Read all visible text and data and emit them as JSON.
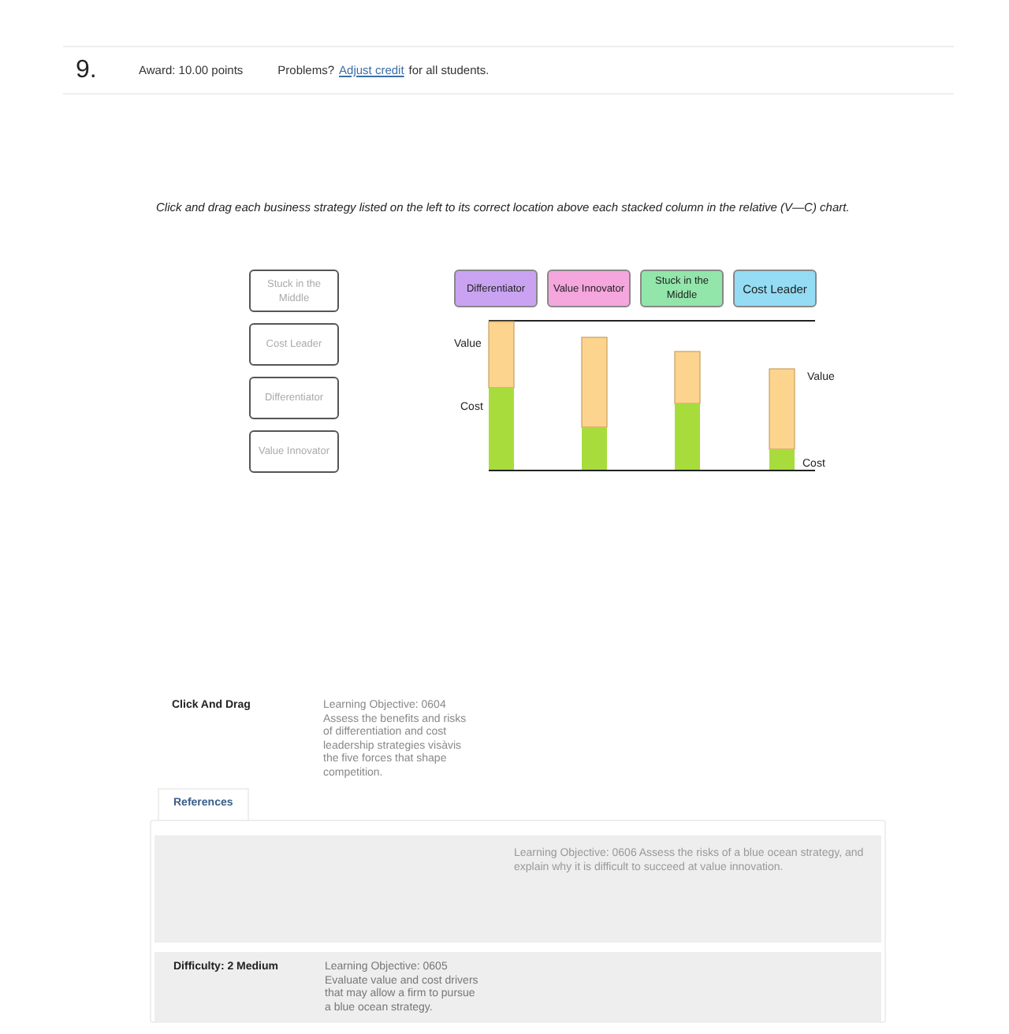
{
  "question": {
    "number": "9.",
    "award": "Award: 10.00 points",
    "problems_label": "Problems?",
    "adjust_link": "Adjust credit",
    "adjust_suffix": "for all students."
  },
  "instructions": "Click and drag each business strategy listed on the left to its correct location above each stacked column in the relative (V—C) chart.",
  "drag_items": [
    "Stuck in the Middle",
    "Cost Leader",
    "Differentiator",
    "Value Innovator"
  ],
  "drop_targets": [
    {
      "label": "Differentiator",
      "color": "#c9a3f2"
    },
    {
      "label": "Value Innovator",
      "color": "#f4a6dd"
    },
    {
      "label": "Stuck in the Middle",
      "color": "#92e6aa"
    },
    {
      "label": "Cost Leader",
      "color": "#94dcf4"
    }
  ],
  "chart_labels": [
    "Value",
    "Cost",
    "Value",
    "Cost"
  ],
  "meta": {
    "type": "Click And Drag",
    "objective_1": "Learning Objective: 0604 Assess the benefits and risks of differentiation and cost leadership strategies visàvis the five forces that shape competition.",
    "references_tab": "References",
    "objective_2": "Learning Objective: 0606 Assess the risks of a blue ocean strategy, and explain why it is difficult to succeed at value innovation.",
    "difficulty": "Difficulty: 2 Medium",
    "objective_3": "Learning Objective: 0605 Evaluate value and cost drivers that may allow a firm to pursue a blue ocean strategy."
  }
}
